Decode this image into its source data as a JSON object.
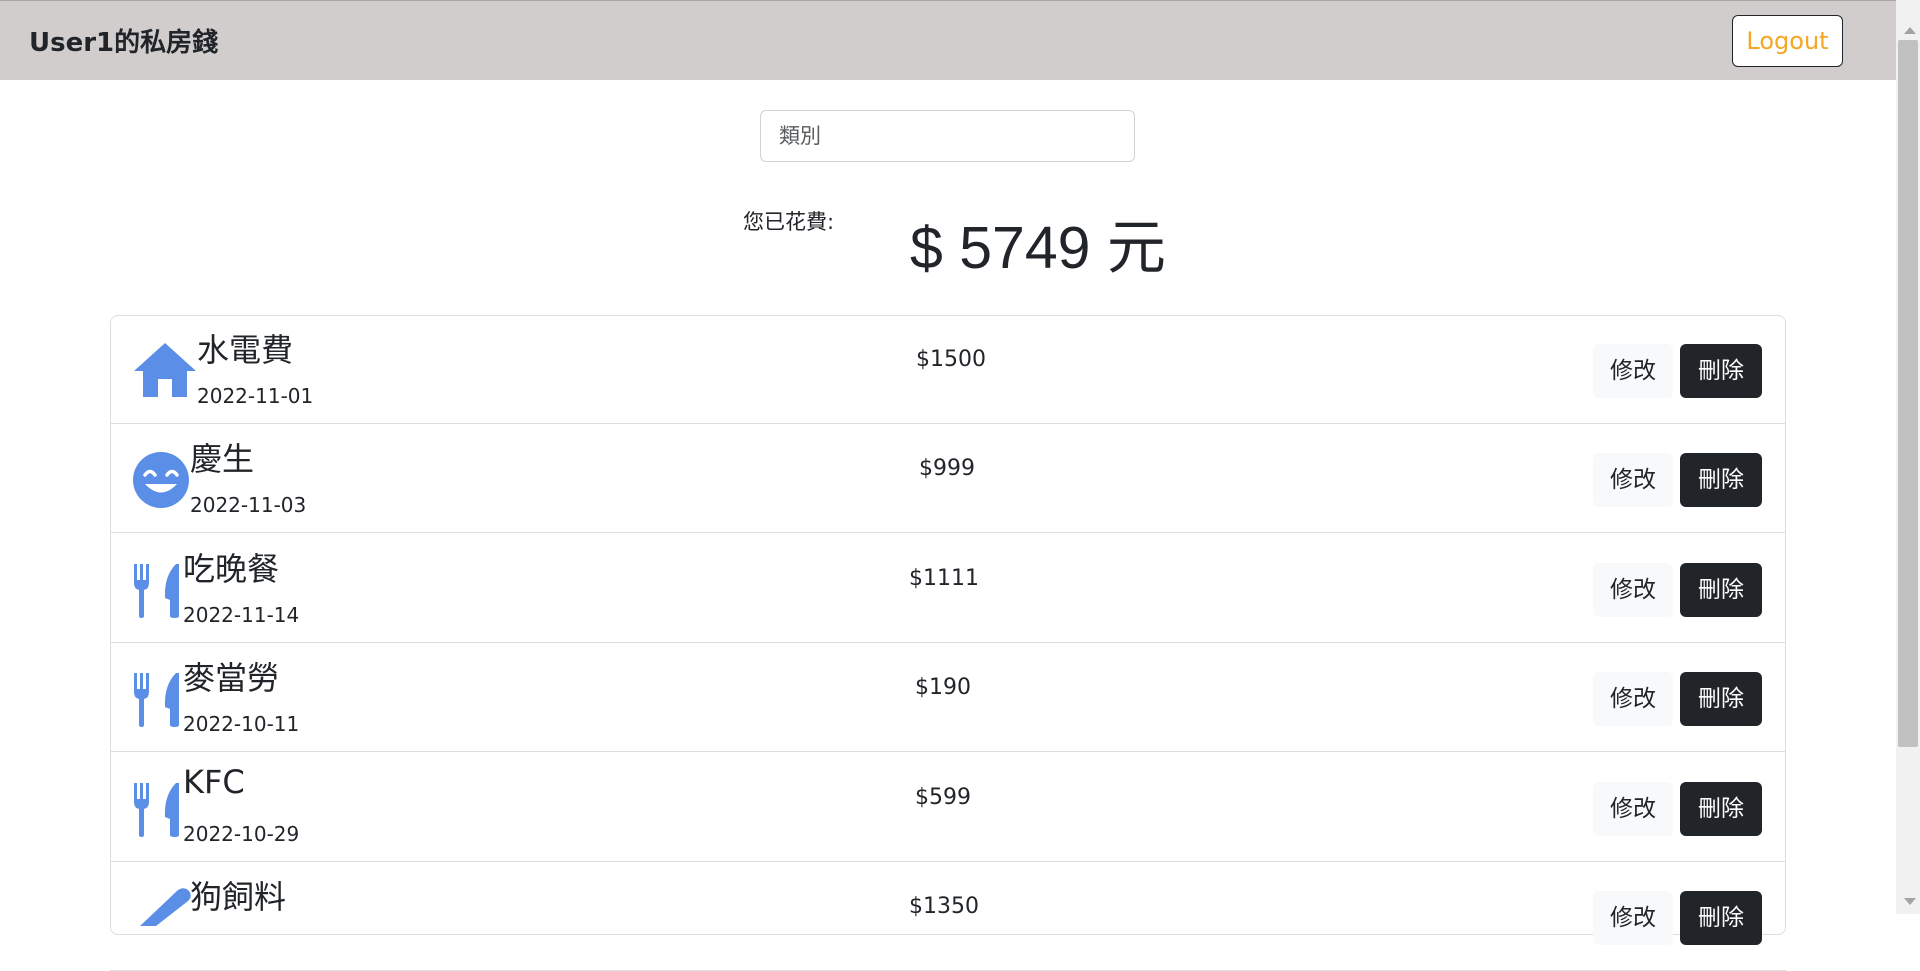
{
  "header": {
    "title": "User1的私房錢",
    "logout_label": "Logout"
  },
  "filter": {
    "placeholder": "類別"
  },
  "summary": {
    "label": "您已花費:",
    "amount_text": "$ 5749 元"
  },
  "records": [
    {
      "icon": "home-icon",
      "name": "水電費",
      "date": "2022-11-01",
      "amount": "$1500",
      "edit_label": "修改",
      "delete_label": "刪除"
    },
    {
      "icon": "smile-icon",
      "name": "慶生",
      "date": "2022-11-03",
      "amount": "$999",
      "edit_label": "修改",
      "delete_label": "刪除"
    },
    {
      "icon": "utensils-icon",
      "name": "吃晚餐",
      "date": "2022-11-14",
      "amount": "$1111",
      "edit_label": "修改",
      "delete_label": "刪除"
    },
    {
      "icon": "utensils-icon",
      "name": "麥當勞",
      "date": "2022-10-11",
      "amount": "$190",
      "edit_label": "修改",
      "delete_label": "刪除"
    },
    {
      "icon": "utensils-icon",
      "name": "KFC",
      "date": "2022-10-29",
      "amount": "$599",
      "edit_label": "修改",
      "delete_label": "刪除"
    },
    {
      "icon": "pen-icon",
      "name": "狗飼料",
      "date": "",
      "amount": "$1350",
      "edit_label": "修改",
      "delete_label": "刪除"
    }
  ],
  "colors": {
    "navbar_bg": "#d0cdcc",
    "icon_blue": "#5b8ee6",
    "logout_text": "#f5a623",
    "delete_bg": "#212529"
  }
}
